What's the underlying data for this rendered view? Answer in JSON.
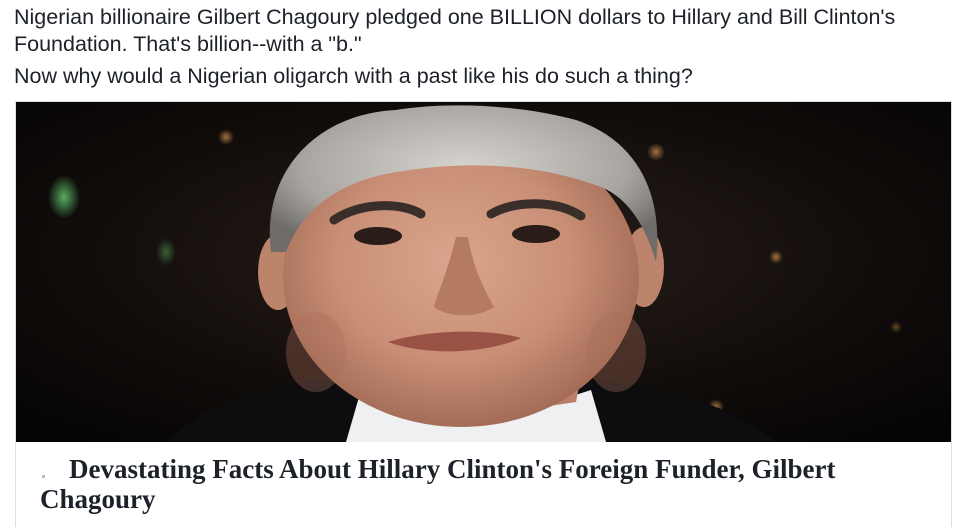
{
  "post": {
    "line1": "Nigerian billionaire Gilbert Chagoury pledged one BILLION dollars to Hillary and Bill Clinton's Foundation. That's billion--with a \"b.\"",
    "line2": "Now why would a Nigerian oligarch with a past like his do such a thing?"
  },
  "link_card": {
    "title": "Devastating Facts About Hillary Clinton's Foreign Funder, Gilbert Chagoury",
    "image_subject": "portrait-photo"
  },
  "colors": {
    "text": "#1d2129",
    "card_border": "#dddfe2",
    "photo_background": "#0c0a0a"
  }
}
